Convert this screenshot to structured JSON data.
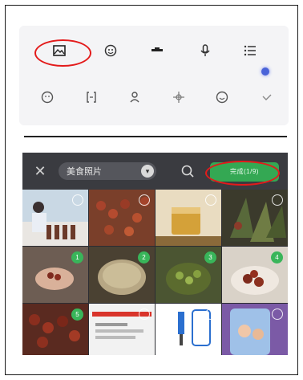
{
  "toolbar": {
    "row1_icons": [
      "image-icon",
      "sticker-icon",
      "minus-bar-icon",
      "microphone-icon",
      "list-icon"
    ],
    "row2_icons": [
      "emoji-icon",
      "bracket-icon",
      "person-icon",
      "move-icon",
      "smile-icon",
      "check-icon"
    ]
  },
  "picker": {
    "close_label": "✕",
    "album_label": "美食照片",
    "send_label": "完成(1/9)"
  },
  "grid": {
    "rows": [
      [
        "photo-woman-kitchen",
        "photo-red-dates",
        "photo-tea-cup",
        "photo-dried-greens"
      ],
      [
        "photo-hand-dates",
        "photo-grain-bowl",
        "photo-green-beans",
        "photo-dates-plate"
      ],
      [
        "photo-dates-pile",
        "photo-screenshot-red",
        "photo-phone-tool",
        "photo-phone-family"
      ]
    ],
    "selected_markers": [
      "1",
      "2",
      "3",
      "4",
      "5"
    ]
  },
  "colors": {
    "highlight": "#e31b1b",
    "accent_green": "#34a853",
    "accent_blue": "#4a63d8",
    "picker_bg": "#2c2d33"
  }
}
